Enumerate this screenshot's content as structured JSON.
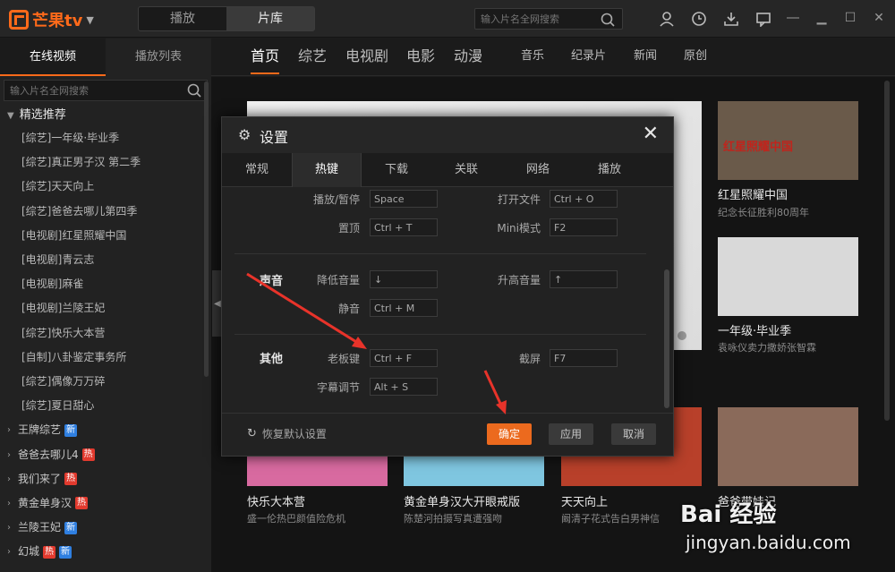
{
  "app": {
    "logo_text": "芒果tv",
    "seg": [
      "播放",
      "片库"
    ],
    "search_placeholder": "输入片名全网搜索"
  },
  "sidebar": {
    "tabs": [
      "在线视频",
      "播放列表"
    ],
    "search_placeholder": "输入片名全网搜索",
    "group": "精选推荐",
    "items": [
      "[综艺]一年级·毕业季",
      "[综艺]真正男子汉 第二季",
      "[综艺]天天向上",
      "[综艺]爸爸去哪儿第四季",
      "[电视剧]红星照耀中国",
      "[电视剧]青云志",
      "[电视剧]麻雀",
      "[电视剧]兰陵王妃",
      "[综艺]快乐大本营",
      "[自制]八卦鉴定事务所",
      "[综艺]偶像万万碎",
      "[综艺]夏日甜心"
    ],
    "categories": [
      {
        "label": "王牌综艺",
        "badges": [
          "新"
        ]
      },
      {
        "label": "爸爸去哪儿4",
        "badges": [
          "热"
        ]
      },
      {
        "label": "我们来了",
        "badges": [
          "热"
        ]
      },
      {
        "label": "黄金单身汉",
        "badges": [
          "热"
        ]
      },
      {
        "label": "兰陵王妃",
        "badges": [
          "新"
        ]
      },
      {
        "label": "幻城",
        "badges": [
          "热",
          "新"
        ]
      }
    ]
  },
  "nav": {
    "big": [
      "首页",
      "综艺",
      "电视剧",
      "电影",
      "动漫"
    ],
    "small": [
      "音乐",
      "纪录片",
      "新闻",
      "原创"
    ]
  },
  "cards": {
    "right1_title": "红星照耀中国",
    "right1_sub": "纪念长征胜利80周年",
    "right2_title": "一年级·毕业季",
    "right2_sub": "袁咏仪卖力撒娇张智霖",
    "bottom": [
      {
        "title": "快乐大本营",
        "sub": "盛一伦热巴颜值险危机"
      },
      {
        "title": "黄金单身汉大开眼戒版",
        "sub": "陈楚河拍摄写真遭强吻"
      },
      {
        "title": "天天向上",
        "sub": "阚清子花式告白男神信"
      },
      {
        "title": "爸爸带娃记",
        "sub": ""
      }
    ],
    "thumb_text": "红星照耀中国"
  },
  "dialog": {
    "title": "设置",
    "tabs": [
      "常规",
      "热键",
      "下载",
      "关联",
      "网络",
      "播放"
    ],
    "active_tab": "热键",
    "rows_top": [
      {
        "left_label": "播放/暂停",
        "left_key": "Space",
        "right_label": "打开文件",
        "right_key": "Ctrl + O"
      },
      {
        "left_label": "置顶",
        "left_key": "Ctrl + T",
        "right_label": "Mini模式",
        "right_key": "F2"
      }
    ],
    "sound": {
      "section": "声音",
      "vol_down_label": "降低音量",
      "vol_down_key": "↓",
      "vol_up_label": "升高音量",
      "vol_up_key": "↑",
      "mute_label": "静音",
      "mute_key": "Ctrl + M"
    },
    "other": {
      "section": "其他",
      "boss_label": "老板键",
      "boss_key": "Ctrl + F",
      "screenshot_label": "截屏",
      "screenshot_key": "F7",
      "subtitle_label": "字幕调节",
      "subtitle_key": "Alt + S"
    },
    "restore": "恢复默认设置",
    "ok": "确定",
    "apply": "应用",
    "cancel": "取消"
  },
  "watermark": {
    "text": "Bai 经验",
    "url": "jingyan.baidu.com"
  },
  "colors": {
    "accent": "#ff6a1a",
    "arrow": "#e8332a",
    "primary_button": "#ec6a1e",
    "badge_new": "#2f7fe0",
    "badge_hot": "#e23a2e"
  }
}
